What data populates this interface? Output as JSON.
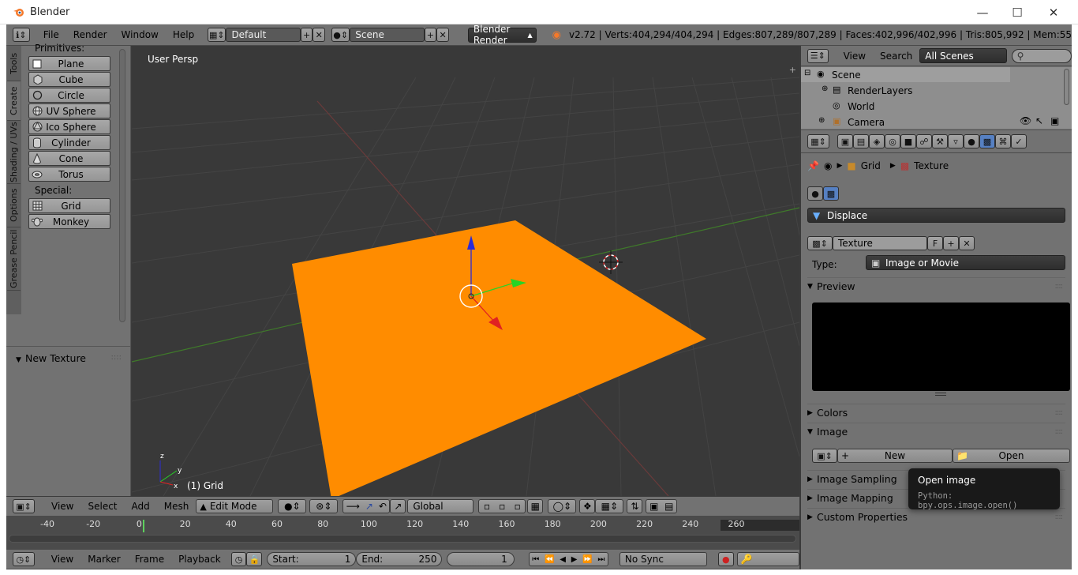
{
  "window": {
    "title": "Blender"
  },
  "info_header": {
    "menus": [
      "File",
      "Render",
      "Window",
      "Help"
    ],
    "layout": "Default",
    "scene": "Scene",
    "engine": "Blender Render",
    "stats": "v2.72 | Verts:404,294/404,294 | Edges:807,289/807,289 | Faces:402,996/402,996 | Tris:805,992 | Mem:55"
  },
  "tool_tabs": [
    "Tools",
    "Create",
    "Shading / UVs",
    "Options",
    "Grease Pencil"
  ],
  "tools": {
    "primitives_label": "Primitives:",
    "primitives": [
      {
        "label": "Plane",
        "icon": "plane-icon"
      },
      {
        "label": "Cube",
        "icon": "cube-icon"
      },
      {
        "label": "Circle",
        "icon": "circle-icon"
      },
      {
        "label": "UV Sphere",
        "icon": "uv-sphere-icon"
      },
      {
        "label": "Ico Sphere",
        "icon": "ico-sphere-icon"
      },
      {
        "label": "Cylinder",
        "icon": "cylinder-icon"
      },
      {
        "label": "Cone",
        "icon": "cone-icon"
      },
      {
        "label": "Torus",
        "icon": "torus-icon"
      }
    ],
    "special_label": "Special:",
    "special": [
      {
        "label": "Grid",
        "icon": "grid-icon"
      },
      {
        "label": "Monkey",
        "icon": "monkey-icon"
      }
    ],
    "operator_panel": "New Texture"
  },
  "viewport": {
    "view_name": "User Persp",
    "object_info": "(1) Grid",
    "axis_x": "x",
    "axis_y": "y",
    "axis_z": "z",
    "plane_color": "#ff8c00"
  },
  "view3d_header": {
    "menus": [
      "View",
      "Select",
      "Add",
      "Mesh"
    ],
    "mode": "Edit Mode",
    "orientation": "Global"
  },
  "outliner": {
    "menus": [
      "View",
      "Search"
    ],
    "filter": "All Scenes",
    "items": [
      {
        "label": "Scene"
      },
      {
        "label": "RenderLayers"
      },
      {
        "label": "World"
      },
      {
        "label": "Camera"
      }
    ]
  },
  "properties": {
    "breadcrumb": [
      "Grid",
      "Texture"
    ],
    "context": "Displace",
    "texture_name": "Texture",
    "fake_user": "F",
    "type_label": "Type:",
    "type_value": "Image or Movie",
    "panels": {
      "preview": "Preview",
      "colors": "Colors",
      "image": "Image",
      "image_sampling": "Image Sampling",
      "image_mapping": "Image Mapping",
      "custom_props": "Custom Properties"
    },
    "new_label": "New",
    "open_label": "Open"
  },
  "tooltip": {
    "title": "Open image",
    "python": "Python: bpy.ops.image.open()"
  },
  "timeline": {
    "ticks": [
      "-40",
      "-20",
      "0",
      "20",
      "40",
      "60",
      "80",
      "100",
      "120",
      "140",
      "160",
      "180",
      "200",
      "220",
      "240",
      "260"
    ],
    "menus": [
      "View",
      "Marker",
      "Frame",
      "Playback"
    ],
    "start_label": "Start:",
    "start_value": "1",
    "end_label": "End:",
    "end_value": "250",
    "current_frame": "1",
    "sync": "No Sync"
  }
}
